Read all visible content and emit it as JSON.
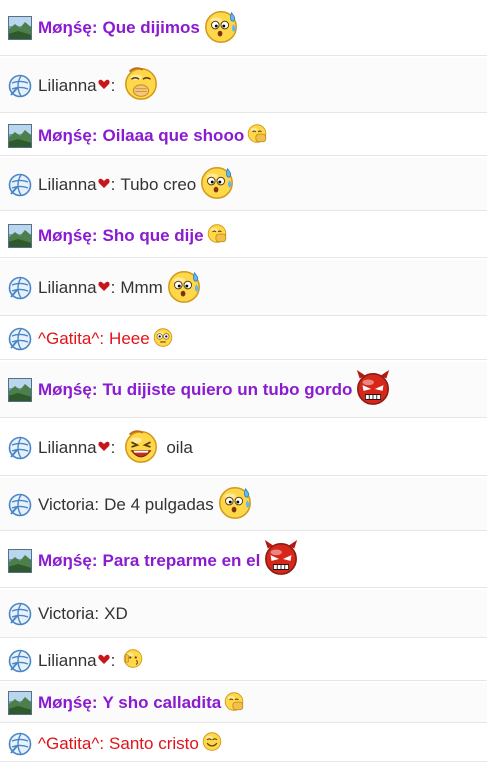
{
  "colors": {
    "monse": "#8a1bd0",
    "liliana": "#333333",
    "gatita": "#e0131a",
    "victoria": "#333333"
  },
  "messages": [
    {
      "user": "Møŋśę",
      "style": "monse",
      "text": "Que dijimos",
      "avatar": "landscape-avatar-icon",
      "emoji": "sweat-face-icon",
      "emoji_size": "big"
    },
    {
      "user": "Lilianna",
      "style": "liliana",
      "text": "",
      "avatar": "globe-avatar-icon",
      "heart": true,
      "emoji": "hand-over-mouth-face-icon",
      "emoji_size": "big"
    },
    {
      "user": "Møŋśę",
      "style": "monse",
      "text": "Oilaaa que shooo",
      "avatar": "landscape-avatar-icon",
      "emoji": "thumbs-face-icon",
      "emoji_size": "small"
    },
    {
      "user": "Lilianna",
      "style": "liliana",
      "text": "Tubo creo",
      "avatar": "globe-avatar-icon",
      "heart": true,
      "emoji": "sweat-face-icon",
      "emoji_size": "big"
    },
    {
      "user": "Møŋśę",
      "style": "monse",
      "text": "Sho que dije",
      "avatar": "landscape-avatar-icon",
      "emoji": "thumbs-face-icon",
      "emoji_size": "small"
    },
    {
      "user": "Lilianna",
      "style": "liliana",
      "text": "Mmm",
      "avatar": "globe-avatar-icon",
      "heart": true,
      "emoji": "sweat-face-icon",
      "emoji_size": "big"
    },
    {
      "user": "^Gatita^",
      "style": "gatita",
      "text": "Heee",
      "avatar": "globe-avatar-icon",
      "emoji": "flushed-face-icon",
      "emoji_size": "small"
    },
    {
      "user": "Møŋśę",
      "style": "monse",
      "text": "Tu dijiste quiero un tubo gordo",
      "avatar": "landscape-avatar-icon",
      "emoji": "devil-face-icon",
      "emoji_size": "big"
    },
    {
      "user": "Lilianna",
      "style": "liliana",
      "text": "oila",
      "avatar": "globe-avatar-icon",
      "heart": true,
      "emoji": "laughing-face-icon",
      "emoji_size": "big",
      "emoji_first": true
    },
    {
      "user": "Victoria",
      "style": "victoria",
      "text": "De 4 pulgadas",
      "avatar": "globe-avatar-icon",
      "emoji": "sweat-face-icon",
      "emoji_size": "big"
    },
    {
      "user": "Møŋśę",
      "style": "monse",
      "text": "Para treparme en el",
      "avatar": "landscape-avatar-icon",
      "emoji": "devil-face-icon",
      "emoji_size": "big"
    },
    {
      "user": "Victoria",
      "style": "victoria",
      "text": "XD",
      "avatar": "globe-avatar-icon",
      "emoji": "",
      "emoji_size": ""
    },
    {
      "user": "Lilianna",
      "style": "liliana",
      "text": "",
      "avatar": "globe-avatar-icon",
      "heart": true,
      "emoji": "shy-face-icon",
      "emoji_size": "small"
    },
    {
      "user": "Møŋśę",
      "style": "monse",
      "text": "Y sho calladita",
      "avatar": "landscape-avatar-icon",
      "emoji": "thumbs-face-icon",
      "emoji_size": "small"
    },
    {
      "user": "^Gatita^",
      "style": "gatita",
      "text": "Santo cristo",
      "avatar": "globe-avatar-icon",
      "emoji": "smile-face-icon",
      "emoji_size": "small"
    }
  ]
}
